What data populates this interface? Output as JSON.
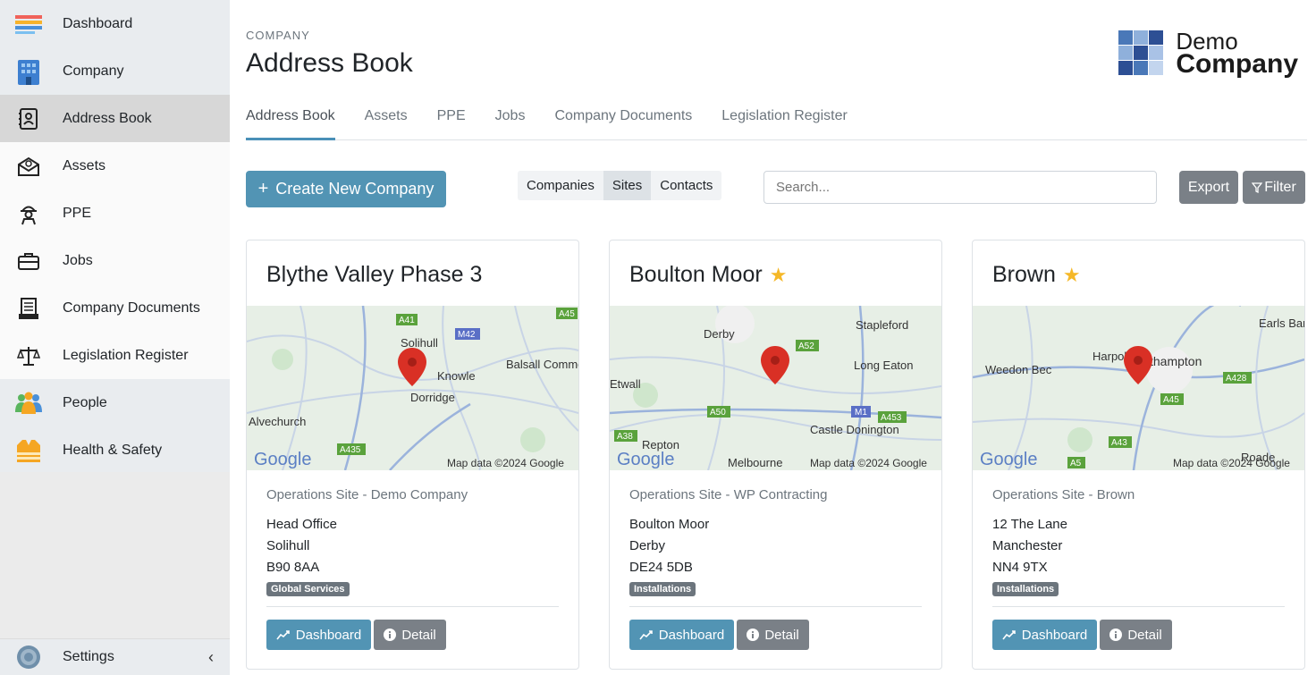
{
  "sidebar": {
    "top": [
      {
        "label": "Dashboard",
        "icon": "dashboard-icon"
      },
      {
        "label": "Company",
        "icon": "building-icon"
      }
    ],
    "sub": [
      {
        "label": "Address Book",
        "icon": "address-book-icon",
        "active": true
      },
      {
        "label": "Assets",
        "icon": "assets-icon"
      },
      {
        "label": "PPE",
        "icon": "ppe-icon"
      },
      {
        "label": "Jobs",
        "icon": "briefcase-icon"
      },
      {
        "label": "Company Documents",
        "icon": "documents-icon"
      },
      {
        "label": "Legislation Register",
        "icon": "scales-icon"
      }
    ],
    "bottom": [
      {
        "label": "People",
        "icon": "people-icon"
      },
      {
        "label": "Health & Safety",
        "icon": "safety-vest-icon"
      }
    ],
    "settings_label": "Settings",
    "collapse_glyph": "‹"
  },
  "header": {
    "breadcrumb": "COMPANY",
    "title": "Address Book",
    "logo_line1": "Demo",
    "logo_line2": "Company"
  },
  "tabs": [
    "Address Book",
    "Assets",
    "PPE",
    "Jobs",
    "Company Documents",
    "Legislation Register"
  ],
  "toolbar": {
    "create_label": "Create New Company",
    "create_glyph": "+",
    "segments": [
      "Companies",
      "Sites",
      "Contacts"
    ],
    "active_segment": "Sites",
    "search_placeholder": "Search...",
    "export_label": "Export",
    "filter_label": "Filter"
  },
  "cards": [
    {
      "title": "Blythe Valley Phase 3",
      "starred": false,
      "site_type": "Operations Site - Demo Company",
      "address": [
        "Head Office",
        "Solihull",
        "B90 8AA"
      ],
      "badge": "Global Services",
      "map_labels": [
        "Solihull",
        "Knowle",
        "Dorridge",
        "Balsall Common",
        "Alvechurch",
        "A41",
        "M42",
        "A45",
        "A435"
      ],
      "map_attr": "Map data ©2024 Google",
      "dashboard_label": "Dashboard",
      "detail_label": "Detail"
    },
    {
      "title": "Boulton Moor",
      "starred": true,
      "site_type": "Operations Site - WP Contracting",
      "address": [
        "Boulton Moor",
        "Derby",
        "DE24 5DB"
      ],
      "badge": "Installations",
      "map_labels": [
        "Derby",
        "Stapleford",
        "Long Eaton",
        "Etwall",
        "Castle Donington",
        "Repton",
        "Melbourne",
        "A52",
        "A50",
        "M1",
        "A453",
        "A38"
      ],
      "map_attr": "Map data ©2024 Google",
      "dashboard_label": "Dashboard",
      "detail_label": "Detail"
    },
    {
      "title": "Brown",
      "starred": true,
      "site_type": "Operations Site - Brown",
      "address": [
        "12 The Lane",
        "Manchester",
        "NN4 9TX"
      ],
      "badge": "Installations",
      "map_labels": [
        "Earls Barto",
        "Harpole",
        "Weedon Bec",
        "thampton",
        "Roade",
        "A428",
        "A45",
        "A43",
        "A5"
      ],
      "map_attr": "Map data ©2024 Google",
      "dashboard_label": "Dashboard",
      "detail_label": "Detail"
    }
  ],
  "colors": {
    "primary": "#5294b4",
    "secondary": "#7a8087",
    "star": "#f5b828",
    "pin": "#d93025"
  }
}
